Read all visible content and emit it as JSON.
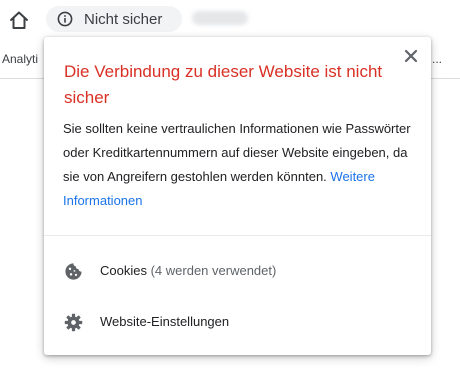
{
  "toolbar": {
    "home_icon": "home-icon",
    "security_chip": {
      "icon": "info-icon",
      "label": "Nicht sicher"
    }
  },
  "bookmarks": {
    "first": "Analyti",
    "more": "..."
  },
  "popup": {
    "title": "Die Verbindung zu dieser Website ist nicht sicher",
    "description": "Sie sollten keine vertraulichen Informationen wie Passwörter oder Kreditkartennummern auf dieser Website eingeben, da sie von Angreifern gestohlen werden könnten.",
    "learn_more": "Weitere Informationen",
    "close_icon": "close-icon",
    "cookies": {
      "icon": "cookie-icon",
      "label": "Cookies",
      "detail": "(4 werden verwendet)"
    },
    "site_settings": {
      "icon": "gear-icon",
      "label": "Website-Einstellungen"
    }
  },
  "colors": {
    "title_red": "#d93025",
    "link_blue": "#1a73e8",
    "chip_bg": "#f1f3f4",
    "icon_gray": "#5f6368"
  }
}
